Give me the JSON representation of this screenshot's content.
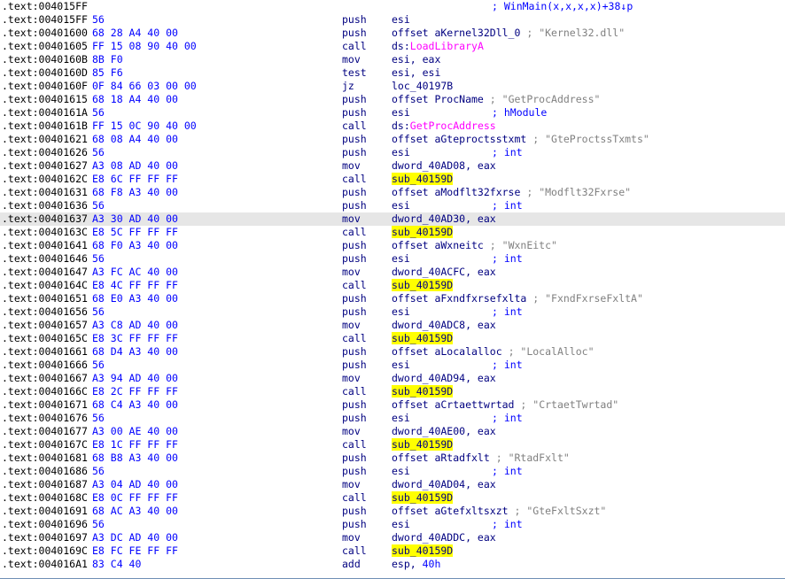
{
  "header": {
    "address": ".text:004015FF",
    "comment": "; WinMain(x,x,x,x)+38↓p"
  },
  "rows": [
    {
      "addr": ".text:004015FF",
      "bytes": "56",
      "mnem": "push",
      "ops": "esi"
    },
    {
      "addr": ".text:00401600",
      "bytes": "68 28 A4 40 00",
      "mnem": "push",
      "ops": "offset aKernel32Dll_0",
      "str": "; \"Kernel32.dll\""
    },
    {
      "addr": ".text:00401605",
      "bytes": "FF 15 08 90 40 00",
      "mnem": "call",
      "ops": "ds:",
      "imp": "LoadLibraryA"
    },
    {
      "addr": ".text:0040160B",
      "bytes": "8B F0",
      "mnem": "mov",
      "ops": "esi, eax"
    },
    {
      "addr": ".text:0040160D",
      "bytes": "85 F6",
      "mnem": "test",
      "ops": "esi, esi"
    },
    {
      "addr": ".text:0040160F",
      "bytes": "0F 84 66 03 00 00",
      "mnem": "jz",
      "ops": "loc_40197B"
    },
    {
      "addr": ".text:00401615",
      "bytes": "68 18 A4 40 00",
      "mnem": "push",
      "ops": "offset ProcName",
      "str": "; \"GetProcAddress\""
    },
    {
      "addr": ".text:0040161A",
      "bytes": "56",
      "mnem": "push",
      "ops": "esi",
      "cmt": "; hModule"
    },
    {
      "addr": ".text:0040161B",
      "bytes": "FF 15 0C 90 40 00",
      "mnem": "call",
      "ops": "ds:",
      "imp": "GetProcAddress"
    },
    {
      "addr": ".text:00401621",
      "bytes": "68 08 A4 40 00",
      "mnem": "push",
      "ops": "offset aGteproctsstxmt",
      "str": "; \"GteProctssTxmts\""
    },
    {
      "addr": ".text:00401626",
      "bytes": "56",
      "mnem": "push",
      "ops": "esi",
      "cmt": "; int"
    },
    {
      "addr": ".text:00401627",
      "bytes": "A3 08 AD 40 00",
      "mnem": "mov",
      "ops": "dword_40AD08, eax"
    },
    {
      "addr": ".text:0040162C",
      "bytes": "E8 6C FF FF FF",
      "mnem": "call",
      "hl": "sub_40159D"
    },
    {
      "addr": ".text:00401631",
      "bytes": "68 F8 A3 40 00",
      "mnem": "push",
      "ops": "offset aModflt32fxrse",
      "str": "; \"Modflt32Fxrse\""
    },
    {
      "addr": ".text:00401636",
      "bytes": "56",
      "mnem": "push",
      "ops": "esi",
      "cmt": "; int"
    },
    {
      "addr": ".text:00401637",
      "bytes": "A3 30 AD 40 00",
      "mnem": "mov",
      "ops": "dword_40AD30, eax",
      "selected": true
    },
    {
      "addr": ".text:0040163C",
      "bytes": "E8 5C FF FF FF",
      "mnem": "call",
      "hl": "sub_40159D"
    },
    {
      "addr": ".text:00401641",
      "bytes": "68 F0 A3 40 00",
      "mnem": "push",
      "ops": "offset aWxneitc",
      "str": "; \"WxnEitc\""
    },
    {
      "addr": ".text:00401646",
      "bytes": "56",
      "mnem": "push",
      "ops": "esi",
      "cmt": "; int"
    },
    {
      "addr": ".text:00401647",
      "bytes": "A3 FC AC 40 00",
      "mnem": "mov",
      "ops": "dword_40ACFC, eax"
    },
    {
      "addr": ".text:0040164C",
      "bytes": "E8 4C FF FF FF",
      "mnem": "call",
      "hl": "sub_40159D"
    },
    {
      "addr": ".text:00401651",
      "bytes": "68 E0 A3 40 00",
      "mnem": "push",
      "ops": "offset aFxndfxrsefxlta",
      "str": "; \"FxndFxrseFxltA\""
    },
    {
      "addr": ".text:00401656",
      "bytes": "56",
      "mnem": "push",
      "ops": "esi",
      "cmt": "; int"
    },
    {
      "addr": ".text:00401657",
      "bytes": "A3 C8 AD 40 00",
      "mnem": "mov",
      "ops": "dword_40ADC8, eax"
    },
    {
      "addr": ".text:0040165C",
      "bytes": "E8 3C FF FF FF",
      "mnem": "call",
      "hl": "sub_40159D"
    },
    {
      "addr": ".text:00401661",
      "bytes": "68 D4 A3 40 00",
      "mnem": "push",
      "ops": "offset aLocalalloc",
      "str": "; \"LocalAlloc\""
    },
    {
      "addr": ".text:00401666",
      "bytes": "56",
      "mnem": "push",
      "ops": "esi",
      "cmt": "; int"
    },
    {
      "addr": ".text:00401667",
      "bytes": "A3 94 AD 40 00",
      "mnem": "mov",
      "ops": "dword_40AD94, eax"
    },
    {
      "addr": ".text:0040166C",
      "bytes": "E8 2C FF FF FF",
      "mnem": "call",
      "hl": "sub_40159D"
    },
    {
      "addr": ".text:00401671",
      "bytes": "68 C4 A3 40 00",
      "mnem": "push",
      "ops": "offset aCrtaettwrtad",
      "str": "; \"CrtaetTwrtad\""
    },
    {
      "addr": ".text:00401676",
      "bytes": "56",
      "mnem": "push",
      "ops": "esi",
      "cmt": "; int"
    },
    {
      "addr": ".text:00401677",
      "bytes": "A3 00 AE 40 00",
      "mnem": "mov",
      "ops": "dword_40AE00, eax"
    },
    {
      "addr": ".text:0040167C",
      "bytes": "E8 1C FF FF FF",
      "mnem": "call",
      "hl": "sub_40159D"
    },
    {
      "addr": ".text:00401681",
      "bytes": "68 B8 A3 40 00",
      "mnem": "push",
      "ops": "offset aRtadfxlt",
      "str": "; \"RtadFxlt\""
    },
    {
      "addr": ".text:00401686",
      "bytes": "56",
      "mnem": "push",
      "ops": "esi",
      "cmt": "; int"
    },
    {
      "addr": ".text:00401687",
      "bytes": "A3 04 AD 40 00",
      "mnem": "mov",
      "ops": "dword_40AD04, eax"
    },
    {
      "addr": ".text:0040168C",
      "bytes": "E8 0C FF FF FF",
      "mnem": "call",
      "hl": "sub_40159D"
    },
    {
      "addr": ".text:00401691",
      "bytes": "68 AC A3 40 00",
      "mnem": "push",
      "ops": "offset aGtefxltsxzt",
      "str": "; \"GteFxltSxzt\""
    },
    {
      "addr": ".text:00401696",
      "bytes": "56",
      "mnem": "push",
      "ops": "esi",
      "cmt": "; int"
    },
    {
      "addr": ".text:00401697",
      "bytes": "A3 DC AD 40 00",
      "mnem": "mov",
      "ops": "dword_40ADDC, eax"
    },
    {
      "addr": ".text:0040169C",
      "bytes": "E8 FC FE FF FF",
      "mnem": "call",
      "hl": "sub_40159D"
    },
    {
      "addr": ".text:004016A1",
      "bytes": "83 C4 40",
      "mnem": "add",
      "ops": "esp, ",
      "num": "40h"
    }
  ]
}
